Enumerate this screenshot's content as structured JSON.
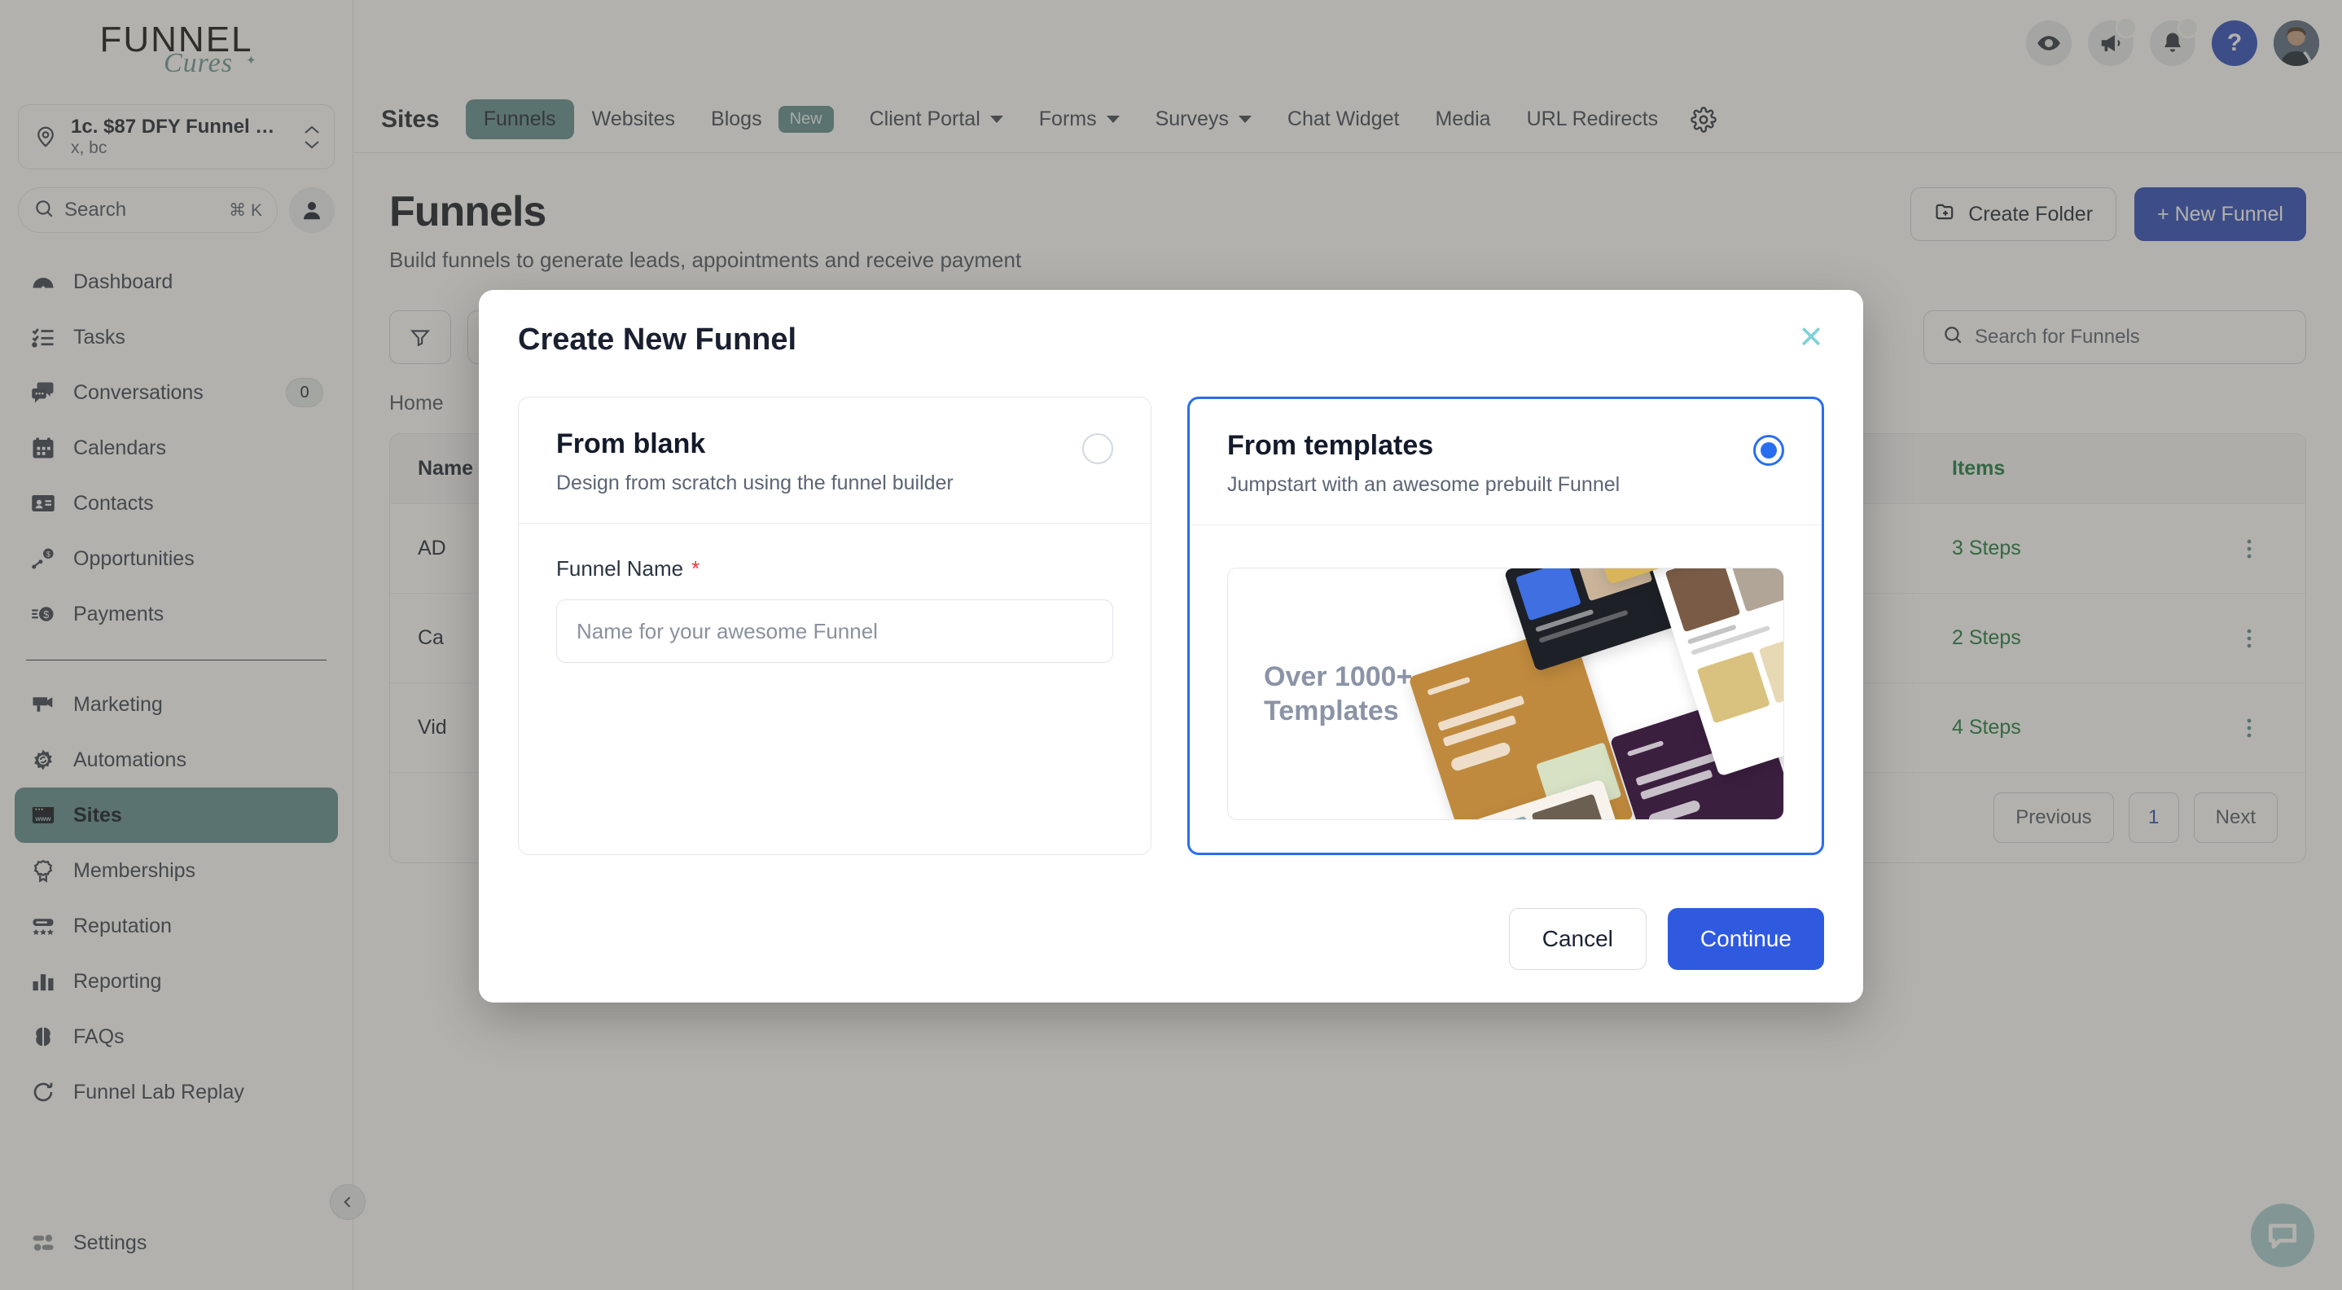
{
  "brand": {
    "logo_main": "FUNNEL",
    "logo_script": "Cures",
    "accent_teal": "#5f8d91",
    "accent_blue": "#2a49ba",
    "modal_blue": "#2f5ae0",
    "chat_teal": "#a8cfd3"
  },
  "sidebar": {
    "location": {
      "name": "1c. $87 DFY Funnel …",
      "sub": "x, bc"
    },
    "search": {
      "placeholder": "Search",
      "shortcut": "⌘ K"
    },
    "items": [
      {
        "label": "Dashboard",
        "icon": "dashboard-icon",
        "badge": ""
      },
      {
        "label": "Tasks",
        "icon": "tasks-icon",
        "badge": ""
      },
      {
        "label": "Conversations",
        "icon": "conversations-icon",
        "badge": "0"
      },
      {
        "label": "Calendars",
        "icon": "calendar-icon",
        "badge": ""
      },
      {
        "label": "Contacts",
        "icon": "contacts-icon",
        "badge": ""
      },
      {
        "label": "Opportunities",
        "icon": "opportunities-icon",
        "badge": ""
      },
      {
        "label": "Payments",
        "icon": "payments-icon",
        "badge": ""
      }
    ],
    "items2": [
      {
        "label": "Marketing",
        "icon": "marketing-icon"
      },
      {
        "label": "Automations",
        "icon": "automations-icon"
      },
      {
        "label": "Sites",
        "icon": "sites-icon",
        "active": true
      },
      {
        "label": "Memberships",
        "icon": "memberships-icon"
      },
      {
        "label": "Reputation",
        "icon": "reputation-icon"
      },
      {
        "label": "Reporting",
        "icon": "reporting-icon"
      },
      {
        "label": "FAQs",
        "icon": "faqs-icon"
      },
      {
        "label": "Funnel Lab Replay",
        "icon": "replay-icon"
      }
    ],
    "settings": {
      "label": "Settings",
      "icon": "settings-icon"
    }
  },
  "topbar": {
    "icons": [
      "eye-icon",
      "megaphone-icon",
      "bell-icon",
      "help-icon",
      "avatar"
    ],
    "help_glyph": "?"
  },
  "nav": {
    "section_title": "Sites",
    "tabs": [
      {
        "label": "Funnels",
        "active": true
      },
      {
        "label": "Websites",
        "active": false
      },
      {
        "label": "Blogs",
        "badge": "New",
        "active": false
      },
      {
        "label": "Client Portal",
        "dropdown": true,
        "active": false
      },
      {
        "label": "Forms",
        "dropdown": true,
        "active": false
      },
      {
        "label": "Surveys",
        "dropdown": true,
        "active": false
      },
      {
        "label": "Chat Widget",
        "active": false
      },
      {
        "label": "Media",
        "active": false
      },
      {
        "label": "URL Redirects",
        "active": false
      }
    ],
    "gear": "gear-icon"
  },
  "page": {
    "title": "Funnels",
    "subtitle": "Build funnels to generate leads, appointments and receive payment",
    "create_folder": "Create Folder",
    "new_funnel": "+ New Funnel",
    "search_funnels_placeholder": "Search for Funnels",
    "breadcrumb": "Home",
    "table": {
      "columns": [
        "Name",
        "Items"
      ],
      "rows": [
        {
          "name": "AD",
          "items": "3 Steps"
        },
        {
          "name": "Ca",
          "items": "2 Steps"
        },
        {
          "name": "Vid",
          "items": "4 Steps"
        }
      ]
    },
    "pagination": {
      "previous": "Previous",
      "page": "1",
      "next": "Next"
    }
  },
  "modal": {
    "title": "Create New Funnel",
    "close": "✕",
    "options": [
      {
        "heading": "From blank",
        "description": "Design from scratch using the funnel builder",
        "selected": false,
        "field_label": "Funnel Name",
        "field_required": "*",
        "field_placeholder": "Name for your awesome Funnel",
        "field_value": ""
      },
      {
        "heading": "From templates",
        "description": "Jumpstart with an awesome prebuilt Funnel",
        "selected": true,
        "preview_text": "Over 1000+\nTemplates"
      }
    ],
    "cancel": "Cancel",
    "continue": "Continue"
  }
}
